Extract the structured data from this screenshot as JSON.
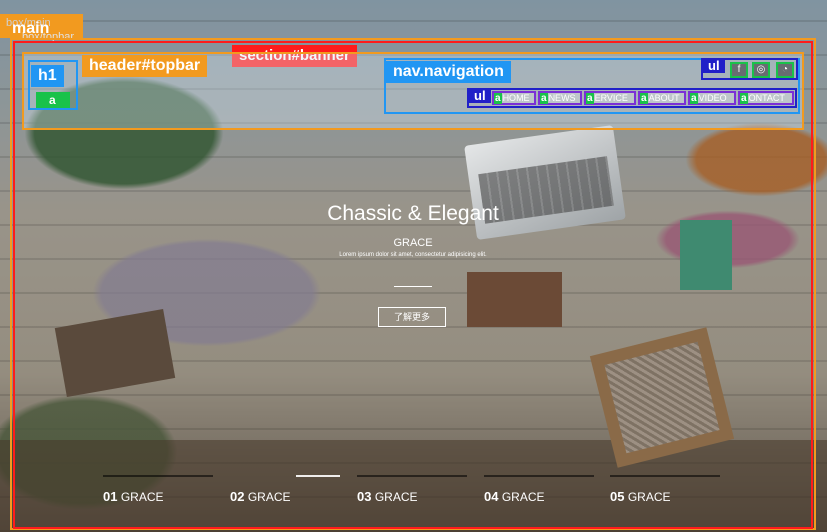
{
  "debug": {
    "corner_label": "box/main",
    "corner_label2": "box/topbar",
    "main_label": "main",
    "banner_label": "section#banner",
    "topbar_label": "header#topbar",
    "nav_label": "nav.navigation",
    "h1_label": "h1",
    "a_label": "a",
    "ul_label": "ul",
    "colors": {
      "orange": "#f29a1f",
      "red": "#ff1b1b",
      "blue": "#2196f3",
      "green": "#19c24a",
      "navy": "#2020c8"
    }
  },
  "nav": {
    "items": [
      {
        "tag": "a",
        "label": "HOME"
      },
      {
        "tag": "a",
        "label": "NEWS"
      },
      {
        "tag": "a",
        "label": "ERVICE"
      },
      {
        "tag": "a",
        "label": "ABOUT"
      },
      {
        "tag": "a",
        "label": "VIDEO"
      },
      {
        "tag": "a",
        "label": "ONTACT"
      }
    ],
    "social_icons": [
      "facebook-icon",
      "wechat-icon",
      "weibo-icon"
    ]
  },
  "hero": {
    "title": "Chassic & Elegant",
    "subtitle": "GRACE",
    "description": "Lorem ipsum dolor sit amet, consectetur adipisicing elit.",
    "button": "了解更多"
  },
  "slides": [
    {
      "num": "01",
      "label": "GRACE"
    },
    {
      "num": "02",
      "label": "GRACE"
    },
    {
      "num": "03",
      "label": "GRACE"
    },
    {
      "num": "04",
      "label": "GRACE"
    },
    {
      "num": "05",
      "label": "GRACE"
    }
  ]
}
